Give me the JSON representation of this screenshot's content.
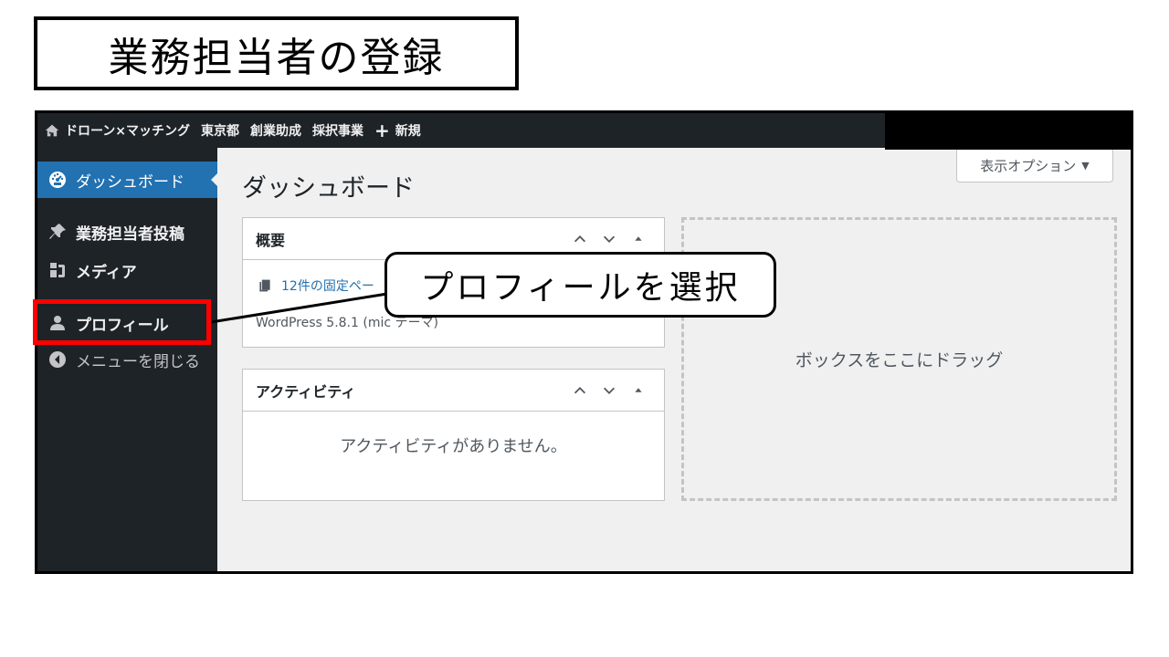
{
  "slide_title": "業務担当者の登録",
  "admin_bar": {
    "site_name": "ドローン×マッチング",
    "items": [
      "東京都",
      "創業助成",
      "採択事業"
    ],
    "new_label": "新規"
  },
  "sidebar": {
    "dashboard": "ダッシュボード",
    "posts": "業務担当者投稿",
    "media": "メディア",
    "profile": "プロフィール",
    "collapse": "メニューを閉じる"
  },
  "screen_options": "表示オプション",
  "page_title": "ダッシュボード",
  "glance_box": {
    "title": "概要",
    "pages": "12件の固定ペー",
    "version": "WordPress 5.8.1 (mic テーマ)"
  },
  "activity_box": {
    "title": "アクティビティ",
    "empty": "アクティビティがありません。"
  },
  "drop_zone": "ボックスをここにドラッグ",
  "callout": "プロフィールを選択",
  "colors": {
    "admin_dark": "#1d2327",
    "accent_blue": "#2271b1",
    "highlight_red": "#ff0000"
  }
}
